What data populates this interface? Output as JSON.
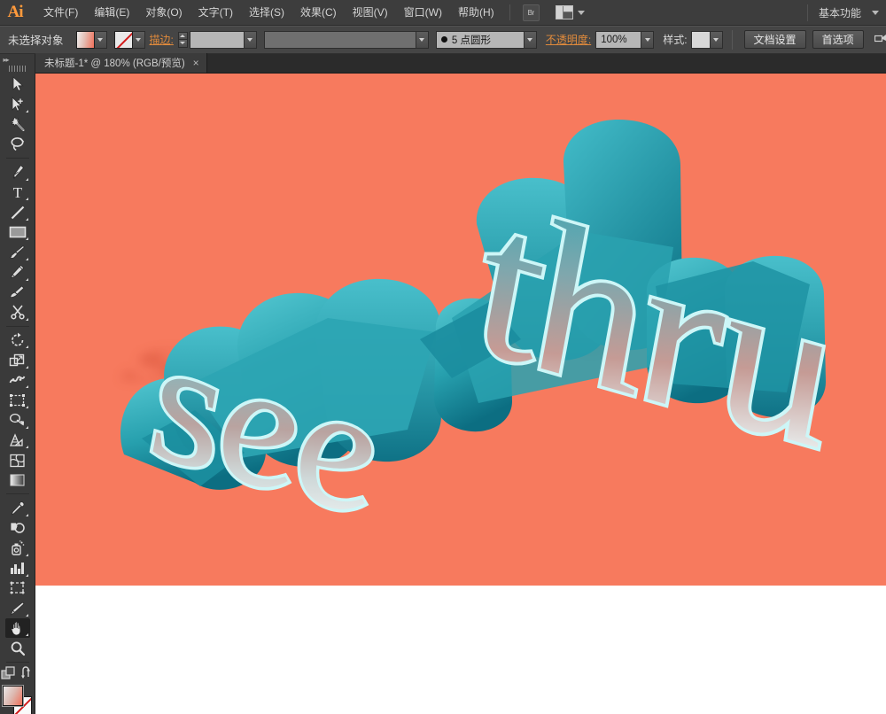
{
  "app": {
    "name": "Adobe Illustrator",
    "logo_text": "Ai"
  },
  "menubar": {
    "items": [
      {
        "label": "文件(F)",
        "name": "menu-file"
      },
      {
        "label": "编辑(E)",
        "name": "menu-edit"
      },
      {
        "label": "对象(O)",
        "name": "menu-object"
      },
      {
        "label": "文字(T)",
        "name": "menu-type"
      },
      {
        "label": "选择(S)",
        "name": "menu-select"
      },
      {
        "label": "效果(C)",
        "name": "menu-effect"
      },
      {
        "label": "视图(V)",
        "name": "menu-view"
      },
      {
        "label": "窗口(W)",
        "name": "menu-window"
      },
      {
        "label": "帮助(H)",
        "name": "menu-help"
      }
    ],
    "bridge_label": "Br",
    "workspace_label": "基本功能"
  },
  "controlbar": {
    "selection_status": "未选择对象",
    "fill_swatch_color": "#f0705a",
    "stroke_swatch_label": "none",
    "stroke_label": "描边:",
    "stroke_weight_value": "",
    "stroke_profile_value": "",
    "brush_value": "5 点圆形",
    "opacity_label": "不透明度:",
    "opacity_value": "100%",
    "style_label": "样式:",
    "doc_setup_label": "文档设置",
    "preferences_label": "首选项"
  },
  "tabbar": {
    "tabs": [
      {
        "title": "未标题-1* @ 180% (RGB/预览)",
        "close": "×",
        "active": true
      }
    ]
  },
  "toolbar": {
    "collapse_glyph": "▸▸",
    "groups": [
      {
        "tools": [
          {
            "name": "selection-tool",
            "label": "选择工具",
            "icon": "arrow-cursor-icon",
            "has_flyout": false,
            "active": false
          },
          {
            "name": "direct-selection-tool",
            "label": "直接选择工具",
            "icon": "direct-select-icon",
            "has_flyout": true,
            "active": false
          },
          {
            "name": "magic-wand-tool",
            "label": "魔棒工具",
            "icon": "magic-wand-icon",
            "has_flyout": false,
            "active": false
          },
          {
            "name": "lasso-tool",
            "label": "套索工具",
            "icon": "lasso-icon",
            "has_flyout": false,
            "active": false
          }
        ]
      },
      {
        "tools": [
          {
            "name": "pen-tool",
            "label": "钢笔工具",
            "icon": "pen-icon",
            "has_flyout": true,
            "active": false
          },
          {
            "name": "type-tool",
            "label": "文字工具",
            "icon": "type-t-icon",
            "has_flyout": true,
            "active": false
          },
          {
            "name": "line-segment-tool",
            "label": "直线段工具",
            "icon": "line-icon",
            "has_flyout": true,
            "active": false
          },
          {
            "name": "rectangle-tool",
            "label": "矩形工具",
            "icon": "rectangle-icon",
            "has_flyout": true,
            "active": false
          },
          {
            "name": "paintbrush-tool",
            "label": "画笔工具",
            "icon": "paintbrush-icon",
            "has_flyout": true,
            "active": false
          },
          {
            "name": "pencil-tool",
            "label": "铅笔工具",
            "icon": "pencil-icon",
            "has_flyout": true,
            "active": false
          },
          {
            "name": "blob-brush-tool",
            "label": "斑点画笔工具",
            "icon": "blob-brush-icon",
            "has_flyout": false,
            "active": false
          },
          {
            "name": "eraser-tool",
            "label": "橡皮擦工具",
            "icon": "scissors-icon",
            "has_flyout": true,
            "active": false
          }
        ]
      },
      {
        "tools": [
          {
            "name": "rotate-tool",
            "label": "旋转工具",
            "icon": "rotate-icon",
            "has_flyout": true,
            "active": false
          },
          {
            "name": "scale-tool",
            "label": "比例缩放工具",
            "icon": "scale-icon",
            "has_flyout": true,
            "active": false
          },
          {
            "name": "width-tool",
            "label": "宽度工具",
            "icon": "warp-icon",
            "has_flyout": true,
            "active": false
          },
          {
            "name": "free-transform-tool",
            "label": "自由变换工具",
            "icon": "free-transform-icon",
            "has_flyout": false,
            "active": false
          },
          {
            "name": "shape-builder-tool",
            "label": "形状生成器工具",
            "icon": "shape-builder-icon",
            "has_flyout": true,
            "active": false
          },
          {
            "name": "perspective-grid-tool",
            "label": "透视网格工具",
            "icon": "perspective-grid-icon",
            "has_flyout": true,
            "active": false
          },
          {
            "name": "mesh-tool",
            "label": "网格工具",
            "icon": "mesh-icon",
            "has_flyout": false,
            "active": false
          },
          {
            "name": "gradient-tool",
            "label": "渐变工具",
            "icon": "gradient-icon",
            "has_flyout": false,
            "active": false
          }
        ]
      },
      {
        "tools": [
          {
            "name": "eyedropper-tool",
            "label": "吸管工具",
            "icon": "eyedropper-icon",
            "has_flyout": true,
            "active": false
          },
          {
            "name": "blend-tool",
            "label": "混合工具",
            "icon": "blend-icon",
            "has_flyout": false,
            "active": false
          },
          {
            "name": "symbol-sprayer-tool",
            "label": "符号喷枪工具",
            "icon": "symbol-sprayer-icon",
            "has_flyout": true,
            "active": false
          },
          {
            "name": "column-graph-tool",
            "label": "柱形图工具",
            "icon": "bar-chart-icon",
            "has_flyout": true,
            "active": false
          },
          {
            "name": "artboard-tool",
            "label": "画板工具",
            "icon": "artboard-icon",
            "has_flyout": false,
            "active": false
          },
          {
            "name": "slice-tool",
            "label": "切片工具",
            "icon": "slice-knife-icon",
            "has_flyout": true,
            "active": false
          },
          {
            "name": "hand-tool",
            "label": "抓手工具",
            "icon": "hand-icon",
            "has_flyout": true,
            "active": true
          },
          {
            "name": "zoom-tool",
            "label": "缩放工具",
            "icon": "magnifier-icon",
            "has_flyout": false,
            "active": false
          }
        ]
      },
      {
        "tools": [
          {
            "name": "fill-stroke-swap-tool",
            "label": "互换填色和描边",
            "icon": "swap-arrow-icon",
            "has_flyout": false,
            "active": false
          }
        ]
      }
    ],
    "fill_color": "#ef6e58",
    "stroke_color": "none"
  },
  "artwork": {
    "title": "see thru",
    "background_color": "#f77a5e",
    "words": [
      {
        "text": "see",
        "name": "artwork-word-see"
      },
      {
        "text": "thru",
        "name": "artwork-word-thru"
      }
    ],
    "extrude_color": "#2b9aa8",
    "face_top_color": "#4cc3cf",
    "face_bottom_color": "#14798c",
    "outline_color": "#cdf6f7",
    "shadow_color": "#e06148"
  },
  "canvas": {
    "zoom_level": "180%",
    "color_mode": "RGB",
    "view_mode": "预览"
  }
}
